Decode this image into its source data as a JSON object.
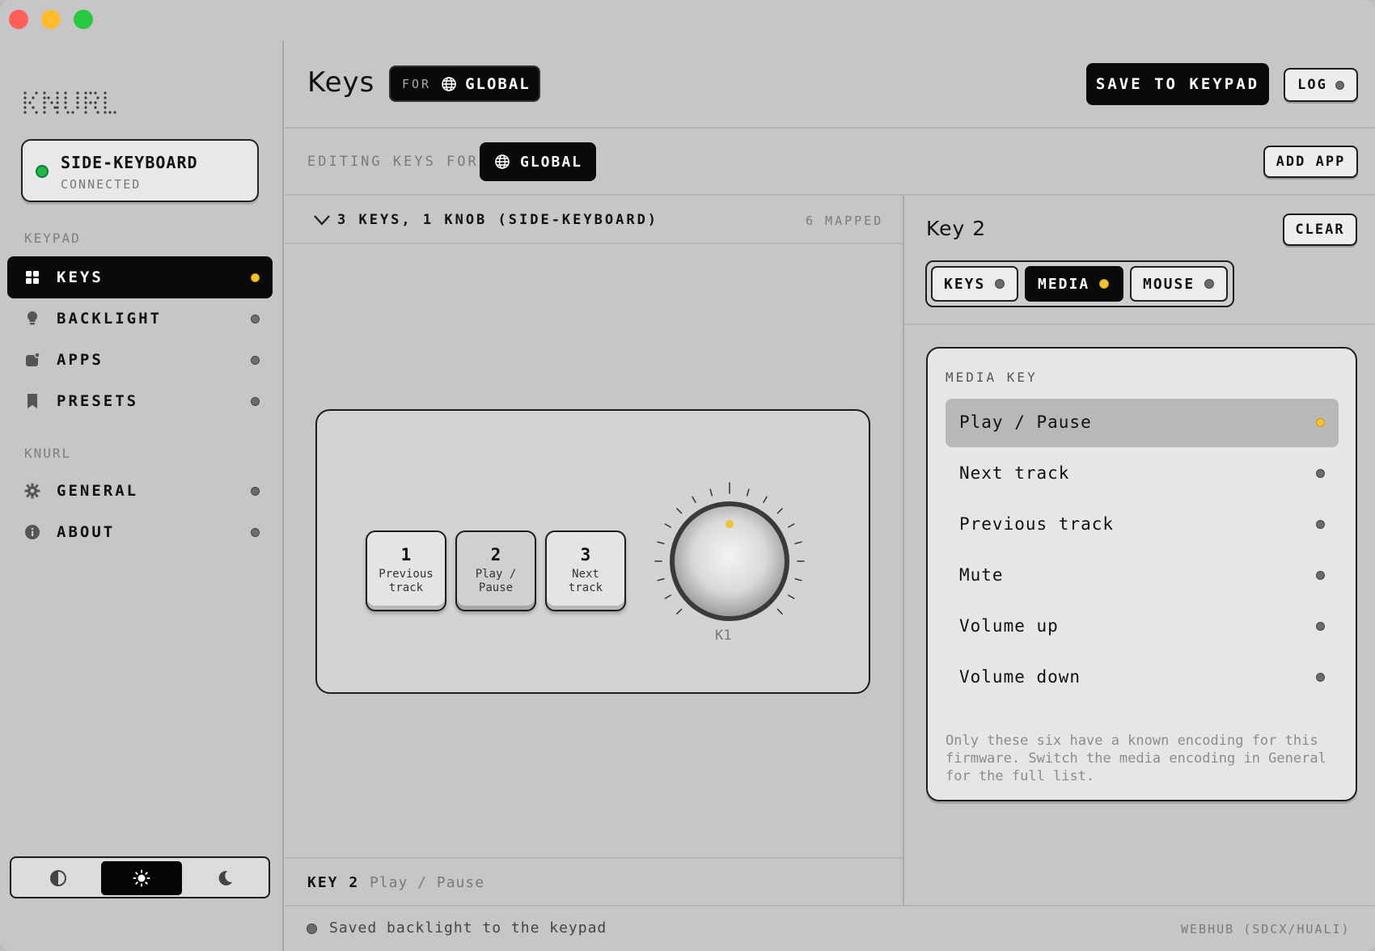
{
  "sidebar": {
    "logo": "KNURL",
    "device": {
      "name": "SIDE-KEYBOARD",
      "status": "CONNECTED"
    },
    "sections": [
      {
        "label": "KEYPAD",
        "items": [
          {
            "label": "KEYS",
            "icon": "grid-icon",
            "active": true
          },
          {
            "label": "BACKLIGHT",
            "icon": "bulb-icon"
          },
          {
            "label": "APPS",
            "icon": "apps-icon"
          },
          {
            "label": "PRESETS",
            "icon": "bookmark-icon"
          }
        ]
      },
      {
        "label": "KNURL",
        "items": [
          {
            "label": "GENERAL",
            "icon": "gear-icon"
          },
          {
            "label": "ABOUT",
            "icon": "info-icon"
          }
        ]
      }
    ],
    "theme": {
      "options": [
        "auto",
        "light",
        "dark"
      ],
      "selected": "light"
    }
  },
  "header": {
    "title": "Keys",
    "scope_prefix": "FOR",
    "scope": "GLOBAL",
    "save_label": "SAVE TO KEYPAD",
    "log_label": "LOG"
  },
  "editing": {
    "label": "EDITING KEYS FOR",
    "scope": "GLOBAL",
    "add_app_label": "ADD APP"
  },
  "layout": {
    "summary": "3 KEYS, 1 KNOB (SIDE-KEYBOARD)",
    "mapped": "6 MAPPED",
    "keys": [
      {
        "num": "1",
        "line1": "Previous",
        "line2": "track"
      },
      {
        "num": "2",
        "line1": "Play /",
        "line2": "Pause"
      },
      {
        "num": "3",
        "line1": "Next",
        "line2": "track"
      }
    ],
    "knob_label": "K1"
  },
  "key_detail": {
    "title": "Key 2",
    "clear_label": "CLEAR",
    "tabs": [
      "KEYS",
      "MEDIA",
      "MOUSE"
    ],
    "active_tab": "MEDIA",
    "media_heading": "MEDIA KEY",
    "media_options": [
      "Play / Pause",
      "Next track",
      "Previous track",
      "Mute",
      "Volume up",
      "Volume down"
    ],
    "selected_option": "Play / Pause",
    "note": "Only these six have a known encoding for this firmware. Switch the media encoding in General for the full list."
  },
  "bottom": {
    "key_label": "KEY 2",
    "key_value": "Play / Pause"
  },
  "status_bar": {
    "message": "Saved backlight to the keypad",
    "right": "WEBHUB (SDCX/HUALI)"
  },
  "colors": {
    "accent_yellow": "#f2c232",
    "connected_green": "#1fb64b",
    "dark": "#0a0a0a"
  }
}
